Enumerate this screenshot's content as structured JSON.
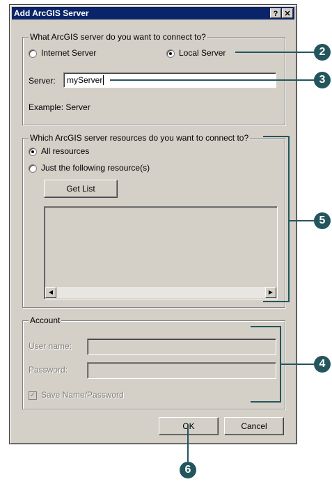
{
  "dialog": {
    "title": "Add ArcGIS Server",
    "help_button": "?",
    "close_button": "✕"
  },
  "server_group": {
    "legend": "What ArcGIS server do you want to connect to?",
    "internet_option": "Internet Server",
    "local_option": "Local Server",
    "selected": "Local Server",
    "server_label": "Server:",
    "server_value": "myServer",
    "example_text": "Example: Server"
  },
  "resources_group": {
    "legend": "Which ArcGIS server resources do you want to connect to?",
    "all_option": "All resources",
    "following_option": "Just the following resource(s)",
    "selected": "All resources",
    "get_list_button": "Get List",
    "scroll_left": "◀",
    "scroll_right": "▶"
  },
  "account_group": {
    "legend": "Account",
    "username_label": "User name:",
    "username_value": "",
    "password_label": "Password:",
    "password_value": "",
    "save_label": "Save Name/Password",
    "save_checked": true,
    "disabled": true
  },
  "buttons": {
    "ok": "OK",
    "cancel": "Cancel"
  },
  "callouts": {
    "c2": "2",
    "c3": "3",
    "c5": "5",
    "c4": "4",
    "c6": "6",
    "color": "#22565c"
  }
}
